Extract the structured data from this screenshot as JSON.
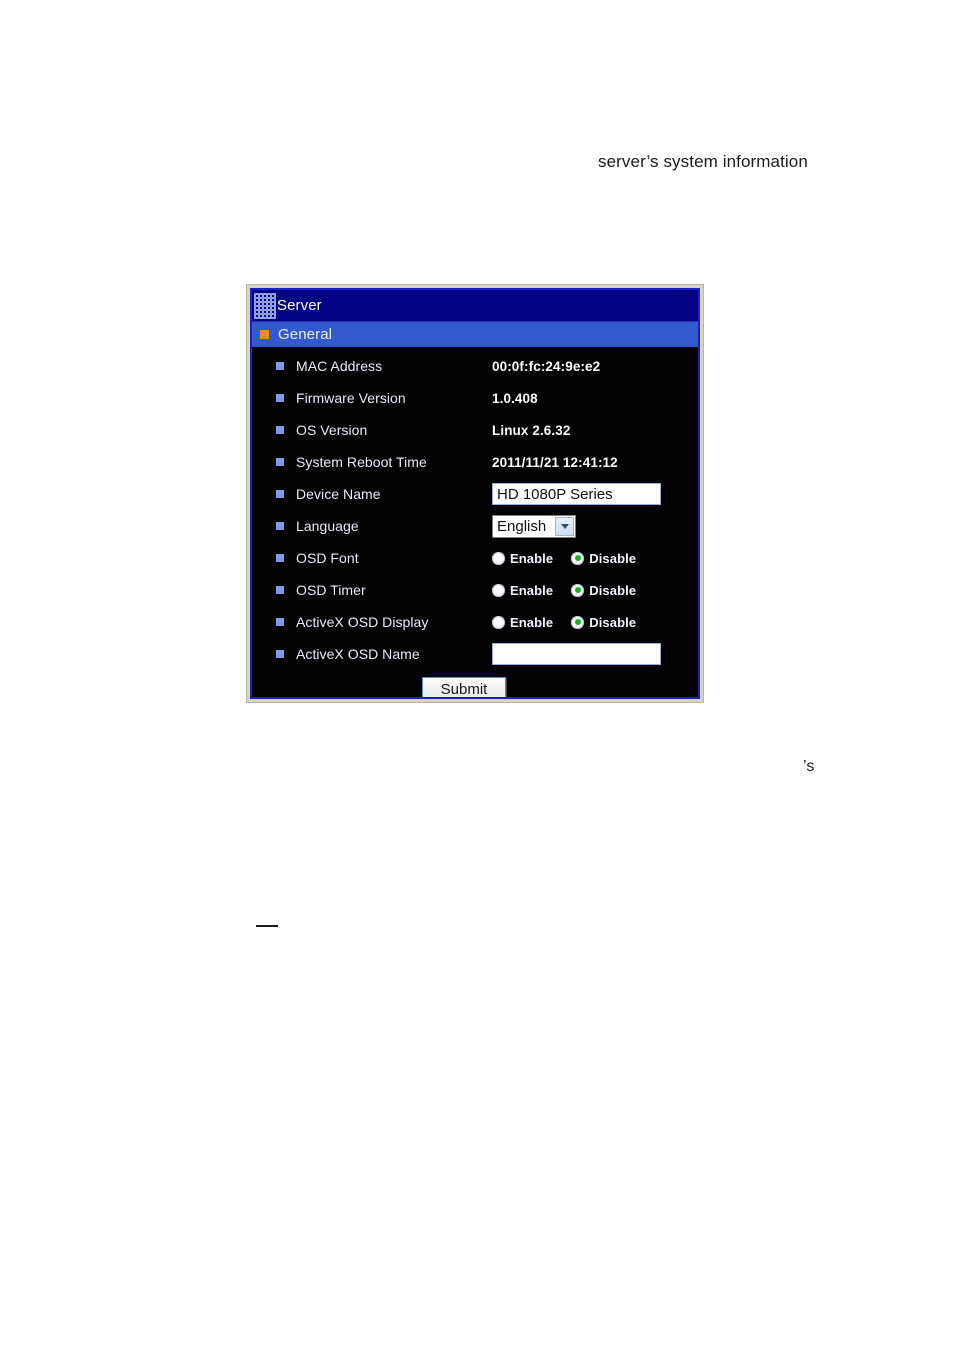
{
  "document": {
    "intro_fragment": "server’s system information",
    "orphan_fragment": "’s"
  },
  "panel": {
    "titlebar": {
      "title": "Server",
      "icon": "grid-dots-icon",
      "background_color": "#000083"
    },
    "section": {
      "label": "General",
      "bullet_color": "#F08A16",
      "background_color": "#3259CF"
    },
    "border_color": "#1921C4",
    "body_background": "#000000",
    "rows": [
      {
        "label": "MAC Address",
        "type": "static",
        "value": "00:0f:fc:24:9e:e2"
      },
      {
        "label": "Firmware Version",
        "type": "static",
        "value": "1.0.408"
      },
      {
        "label": "OS Version",
        "type": "static",
        "value": "Linux 2.6.32"
      },
      {
        "label": "System Reboot Time",
        "type": "static",
        "value": "2011/11/21 12:41:12"
      },
      {
        "label": "Device Name",
        "type": "text",
        "value": "HD 1080P Series",
        "placeholder": ""
      },
      {
        "label": "Language",
        "type": "select",
        "value": "English",
        "options": [
          "English"
        ]
      },
      {
        "label": "OSD Font",
        "type": "radio",
        "value": "Disable",
        "options": [
          "Enable",
          "Disable"
        ]
      },
      {
        "label": "OSD Timer",
        "type": "radio",
        "value": "Disable",
        "options": [
          "Enable",
          "Disable"
        ]
      },
      {
        "label": "ActiveX OSD Display",
        "type": "radio",
        "value": "Disable",
        "options": [
          "Enable",
          "Disable"
        ]
      },
      {
        "label": "ActiveX OSD Name",
        "type": "text",
        "value": "",
        "placeholder": ""
      }
    ],
    "submit": {
      "label": "Submit"
    },
    "radio_selected_color": "#18B01F"
  }
}
